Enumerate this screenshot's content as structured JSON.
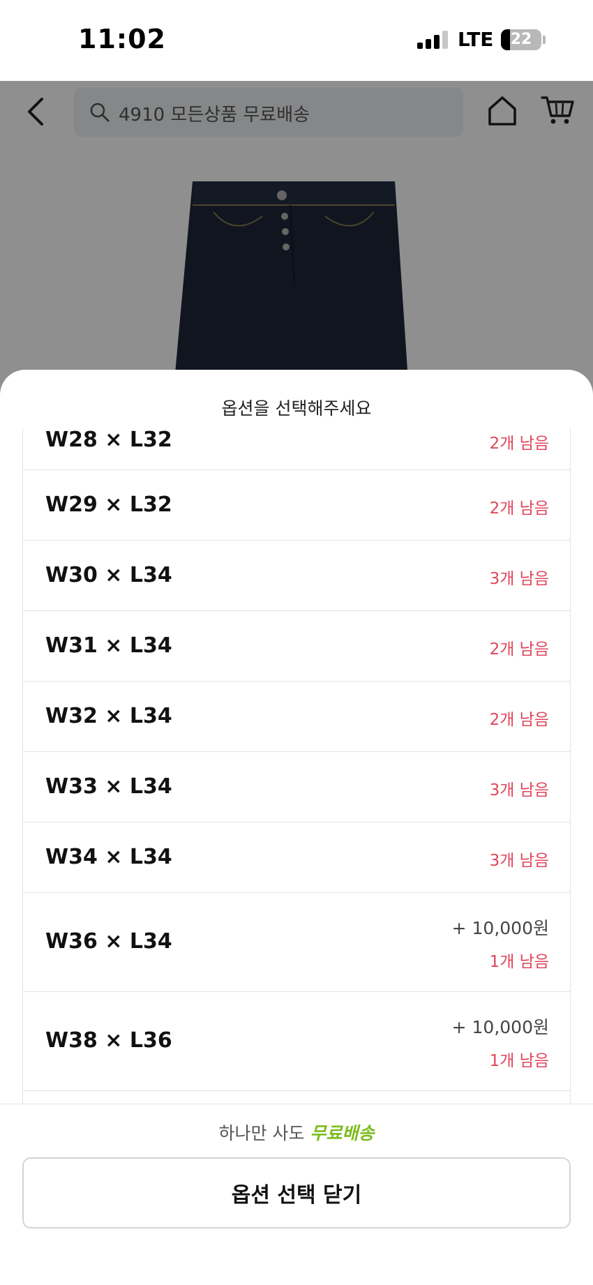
{
  "status_bar": {
    "time": "11:02",
    "network": "LTE",
    "battery": "22",
    "battery_level": 0.22
  },
  "header": {
    "search_text": "4910 모든상품 무료배송",
    "icons": [
      "back-icon",
      "search-icon",
      "home-icon",
      "cart-icon"
    ]
  },
  "sheet": {
    "title": "옵션을 선택해주세요",
    "options": [
      {
        "label": "W28 × L32",
        "stock": "2개 남음",
        "price": ""
      },
      {
        "label": "W29 × L32",
        "stock": "2개 남음",
        "price": ""
      },
      {
        "label": "W30 × L34",
        "stock": "3개 남음",
        "price": ""
      },
      {
        "label": "W31 × L34",
        "stock": "2개 남음",
        "price": ""
      },
      {
        "label": "W32 × L34",
        "stock": "2개 남음",
        "price": ""
      },
      {
        "label": "W33 × L34",
        "stock": "3개 남음",
        "price": ""
      },
      {
        "label": "W34 × L34",
        "stock": "3개 남음",
        "price": ""
      },
      {
        "label": "W36 × L34",
        "stock": "1개 남음",
        "price": "+ 10,000원"
      },
      {
        "label": "W38 × L36",
        "stock": "1개 남음",
        "price": "+ 10,000원"
      }
    ],
    "promo_prefix": "하나만 사도",
    "promo_highlight": "무료배송",
    "close_button": "옵션 선택 닫기"
  },
  "colors": {
    "stock": "#e0465a",
    "promo": "#7cbb1d",
    "divider": "#e3e3e3"
  }
}
